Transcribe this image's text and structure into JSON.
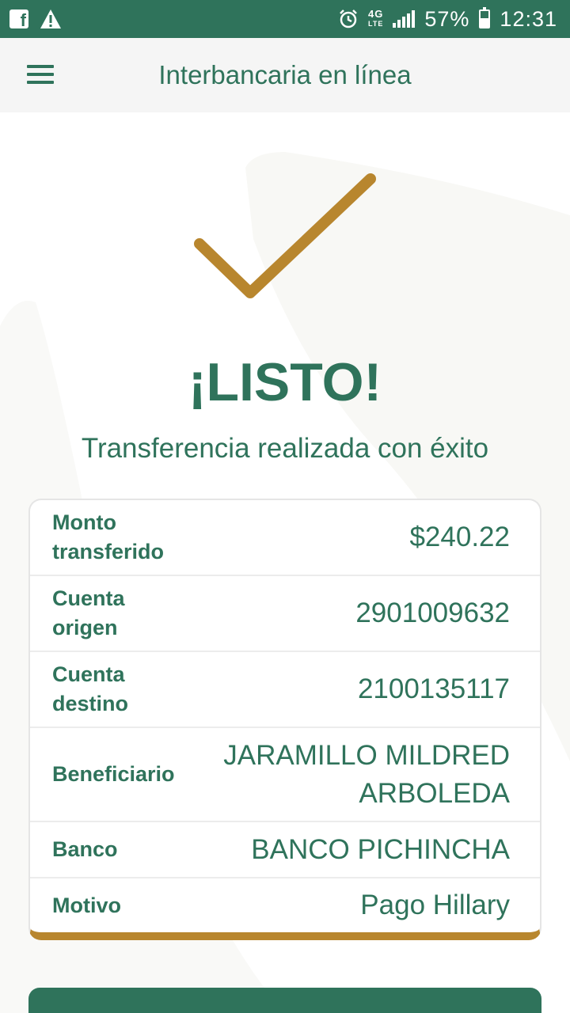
{
  "status_bar": {
    "battery": "57%",
    "time": "12:31",
    "network": "4G",
    "network_sub": "LTE"
  },
  "header": {
    "title": "Interbancaria en línea"
  },
  "result": {
    "heading": "¡LISTO!",
    "message": "Transferencia realizada con éxito"
  },
  "summary": {
    "rows": [
      {
        "label": "Monto transferido",
        "value": "$240.22"
      },
      {
        "label": "Cuenta origen",
        "value": "2901009632"
      },
      {
        "label": "Cuenta destino",
        "value": "2100135117"
      },
      {
        "label": "Beneficiario",
        "value": "JARAMILLO MILDRED ARBOLEDA"
      },
      {
        "label": "Banco",
        "value": "BANCO PICHINCHA"
      },
      {
        "label": "Motivo",
        "value": "Pago Hillary"
      }
    ]
  },
  "colors": {
    "primary_green": "#2f735b",
    "accent_gold": "#b8862e"
  }
}
